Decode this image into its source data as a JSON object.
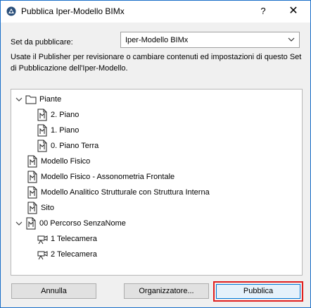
{
  "window": {
    "title": "Pubblica Iper-Modello BIMx",
    "help_label": "?",
    "close_label": "✕"
  },
  "set": {
    "label": "Set da pubblicare:",
    "selected": "Iper-Modello BIMx"
  },
  "description": "Usate il Publisher per revisionare o cambiare contenuti ed impostazioni di questo Set di Pubblicazione dell'Iper-Modello.",
  "tree": {
    "items": [
      {
        "label": "Piante",
        "icon": "folder-icon"
      },
      {
        "label": "2. Piano",
        "icon": "document-icon"
      },
      {
        "label": "1. Piano",
        "icon": "document-icon"
      },
      {
        "label": "0. Piano Terra",
        "icon": "document-icon"
      },
      {
        "label": "Modello Fisico",
        "icon": "document-icon"
      },
      {
        "label": "Modello Fisico - Assonometria Frontale",
        "icon": "document-icon"
      },
      {
        "label": "Modello Analitico Strutturale con Struttura Interna",
        "icon": "document-icon"
      },
      {
        "label": "Sito",
        "icon": "document-icon"
      },
      {
        "label": "00 Percorso SenzaNome",
        "icon": "document-icon"
      },
      {
        "label": "1 Telecamera",
        "icon": "camera-icon"
      },
      {
        "label": "2 Telecamera",
        "icon": "camera-icon"
      }
    ]
  },
  "buttons": {
    "cancel": "Annulla",
    "organizer": "Organizzatore...",
    "publish": "Pubblica"
  },
  "colors": {
    "window_border": "#1a6fc9",
    "primary_focus": "#0078d7",
    "highlight_box": "#e02020"
  }
}
